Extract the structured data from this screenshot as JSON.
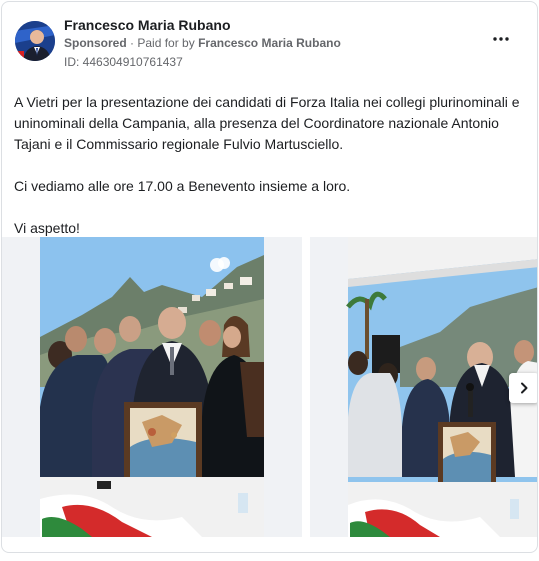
{
  "ad": {
    "page_name": "Francesco Maria Rubano",
    "sponsored_label": "Sponsored",
    "paid_for_prefix": "Paid for by",
    "paid_for_name": "Francesco Maria Rubano",
    "ad_id": "ID: 446304910761437"
  },
  "post": {
    "paragraphs": [
      "A Vietri per la presentazione dei candidati di Forza Italia nei collegi plurinominali e uninominali della Campania, alla presenza del Coordinatore nazionale Antonio Tajani e il Commissario regionale Fulvio Martusciello.",
      "Ci vediamo alle ore 17.00 a Benevento insieme a loro.",
      "Vi aspetto!"
    ]
  },
  "icons": {
    "more": "more-options-icon",
    "next": "chevron-right-icon"
  },
  "colors": {
    "text": "#1c1e21",
    "secondary_text": "#65676b",
    "border": "#dcdfe3",
    "avatar_bg": "#1b3f8c"
  }
}
